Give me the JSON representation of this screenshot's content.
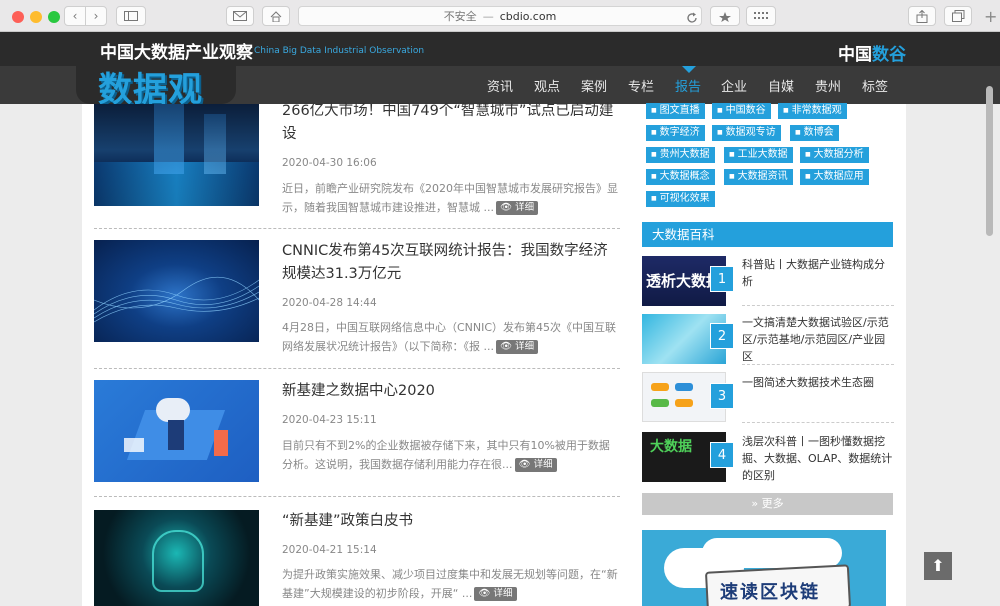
{
  "browser": {
    "security_label": "不安全",
    "url": "cbdio.com",
    "url_separator": "—",
    "nav_back": "‹",
    "nav_forward": "›",
    "new_tab": "+"
  },
  "header": {
    "site_title": "中国大数据产业观察",
    "site_subtitle": "China Big Data Industrial Observation",
    "logo_text": "数据观",
    "brand_part1": "中国",
    "brand_part2": "数谷",
    "nav": [
      "资讯",
      "观点",
      "案例",
      "专栏",
      "报告",
      "企业",
      "自媒",
      "贵州",
      "标签"
    ],
    "nav_active": "报告"
  },
  "articles": [
    {
      "title": "266亿大市场！中国749个“智慧城市”试点已启动建设",
      "date": "2020-04-30 16:06",
      "desc": "近日，前瞻产业研究院发布《2020年中国智慧城市发展研究报告》显示，随着我国智慧城市建设推进，智慧城 ...",
      "more": "详细"
    },
    {
      "title": "CNNIC发布第45次互联网统计报告：我国数字经济规模达31.3万亿元",
      "date": "2020-04-28 14:44",
      "desc": "4月28日，中国互联网络信息中心（CNNIC）发布第45次《中国互联网络发展状况统计报告》（以下简称：《报 ...",
      "more": "详细"
    },
    {
      "title": "新基建之数据中心2020",
      "date": "2020-04-23 15:11",
      "desc": "目前只有不到2%的企业数据被存储下来，其中只有10%被用于数据分析。这说明，我国数据存储利用能力存在很...",
      "more": "详细"
    },
    {
      "title": "“新基建”政策白皮书",
      "date": "2020-04-21 15:14",
      "desc": "为提升政策实施效果、减少项目过度集中和发展无规划等问题，在“新基建”大规模建设的初步阶段，开展“ ...",
      "more": "详细"
    }
  ],
  "tags": [
    "图文直播",
    "中国数谷",
    "非常数据观",
    "数字经济",
    "数据观专访",
    "数博会",
    "贵州大数据",
    "工业大数据",
    "大数据分析",
    "大数据概念",
    "大数据资讯",
    "大数据应用",
    "可视化效果"
  ],
  "wiki": {
    "title": "大数据百科",
    "thumb_texts": [
      "透析大数据",
      "",
      "",
      "大数据"
    ],
    "items": [
      {
        "num": "1",
        "text": "科普贴丨大数据产业链构成分析"
      },
      {
        "num": "2",
        "text": "一文搞清楚大数据试验区/示范区/示范基地/示范园区/产业园区"
      },
      {
        "num": "3",
        "text": "一图简述大数据技术生态圈"
      },
      {
        "num": "4",
        "text": "浅层次科普丨一图秒懂数据挖掘、大数据、OLAP、数据统计的区别"
      }
    ],
    "more": "» 更多"
  },
  "ad_text": "速读区块链",
  "to_top": "⬆"
}
